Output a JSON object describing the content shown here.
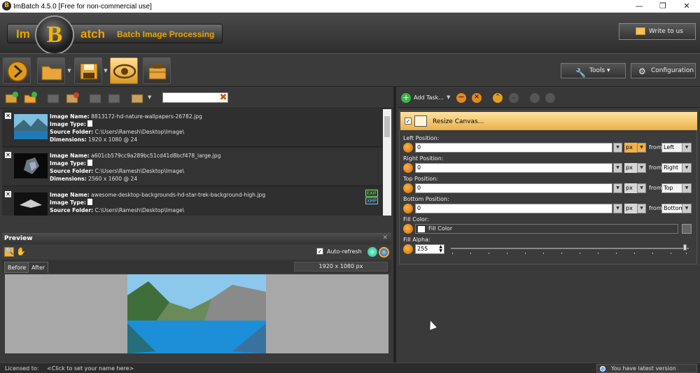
{
  "window": {
    "title": "ImBatch 4.5.0 [Free for non-commercial use]",
    "controls": {
      "minimize": "—",
      "maximize": "❐",
      "close": "✕"
    }
  },
  "header": {
    "brand_im": "Im",
    "brand_b": "B",
    "brand_atch": "atch",
    "brand_subtitle": "Batch Image Processing",
    "write_to_us": "Write to us"
  },
  "toolbar": {
    "tools_label": "Tools ▾",
    "configuration_label": "Configuration"
  },
  "file_filter": {
    "value": ""
  },
  "files": [
    {
      "name_label": "Image Name:",
      "name": "8813172-hd-nature-wallpapers-26782.jpg",
      "type_label": "Image Type:",
      "folder_label": "Source Folder:",
      "folder": "C:\\Users\\Ramesh\\Desktop\\Image\\",
      "dim_label": "Dimensions:",
      "dim": "1920 x 1080 @ 24"
    },
    {
      "name_label": "Image Name:",
      "name": "a601cb579cc9a289bc51cd41d8bcf478_large.jpg",
      "type_label": "Image Type:",
      "folder_label": "Source Folder:",
      "folder": "C:\\Users\\Ramesh\\Desktop\\Image\\",
      "dim_label": "Dimensions:",
      "dim": "2560 x 1600 @ 24"
    },
    {
      "name_label": "Image Name:",
      "name": "awesome-desktop-backgrounds-hd-star-trek-background-high.jpg",
      "type_label": "Image Type:",
      "folder_label": "Source Folder:",
      "folder": "C:\\Users\\Ramesh\\Desktop\\Image\\",
      "badge_exif": "EXIF",
      "badge_xmp": "XMP"
    }
  ],
  "preview": {
    "title": "Preview",
    "auto_refresh": "Auto-refresh",
    "tab_before": "Before",
    "tab_after": "After",
    "dimensions": "1920 x 1080 px"
  },
  "tasks": {
    "add_task": "Add Task...",
    "active_task": "Resize Canvas...",
    "params": [
      {
        "label": "Left Position:",
        "value": "0",
        "unit": "px",
        "from_label": "from",
        "from": "Left"
      },
      {
        "label": "Right Position:",
        "value": "0",
        "unit": "px",
        "from_label": "from",
        "from": "Right"
      },
      {
        "label": "Top Position:",
        "value": "0",
        "unit": "px",
        "from_label": "from",
        "from": "Top"
      },
      {
        "label": "Bottom Position:",
        "value": "0",
        "unit": "px",
        "from_label": "from",
        "from": "Bottom"
      }
    ],
    "fill_color_label": "Fill Color:",
    "fill_color_value": "Fill Color",
    "fill_alpha_label": "Fill Alpha:",
    "fill_alpha_value": "255",
    "fill_alpha_fraction": 1.0
  },
  "status": {
    "licensed_label": "Licensed to:",
    "licensed_value": "<Click to set your name here>",
    "version_msg": "You have latest version"
  },
  "colors": {
    "accent": "#f2b400",
    "highlight": "#f4b04a",
    "panel": "#3a3a3a"
  }
}
